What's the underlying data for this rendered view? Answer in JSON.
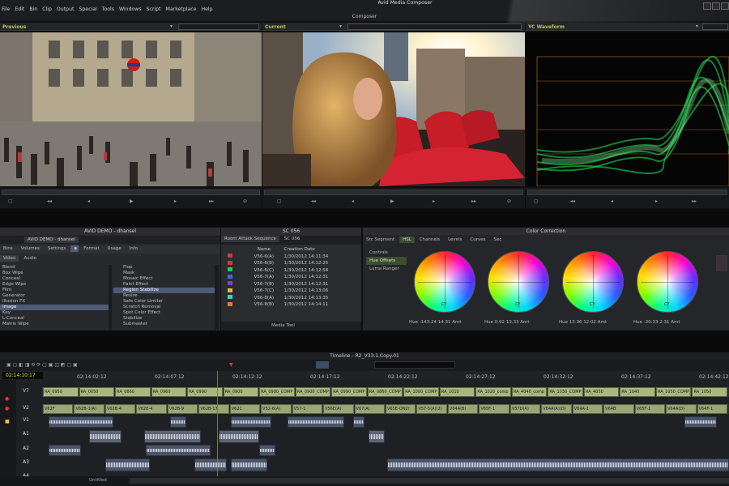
{
  "app": {
    "title": "Avid Media Composer",
    "composer_label": "Composer"
  },
  "menu": [
    "File",
    "Edit",
    "Bin",
    "Clip",
    "Output",
    "Special",
    "Tools",
    "Windows",
    "Script",
    "Marketplace",
    "Help"
  ],
  "monitors": {
    "previous": {
      "label": "Previous"
    },
    "current": {
      "label": "Current"
    },
    "waveform": {
      "label": "YC Waveform"
    }
  },
  "bin_panel": {
    "title": "AVID DEMO - dhansel",
    "tab_label": "AVID DEMO - dhansel",
    "tabs": [
      "Bins",
      "Volumes",
      "Settings",
      "Format",
      "Usage",
      "Info"
    ],
    "subtabs": [
      "Video",
      "Audio"
    ],
    "categories": [
      "Blend",
      "Box Wipe",
      "Conceal",
      "Edge Wipe",
      "Film",
      "Generator",
      "Illusion FX",
      "Image",
      "Key",
      "L-Conceal",
      "Matrix Wipe"
    ],
    "effects": [
      "Flop",
      "Mask",
      "Mosaic Effect",
      "Paint Effect",
      "Region Stabilize",
      "Resize",
      "Safe Color Limiter",
      "Scratch Removal",
      "Spot Color Effect",
      "Stabilize",
      "Submaster"
    ],
    "selected_category": "Image",
    "selected_effect": "Region Stabilize"
  },
  "scene_bin": {
    "title": "SC 056",
    "tabs": [
      "Room Attack Sequence",
      "SC 056"
    ],
    "columns": [
      "Name",
      "Creation Date"
    ],
    "rows": [
      {
        "name": "V56-6(A)",
        "date": "1/30/2012 14:11:34",
        "color": "#d23a3a"
      },
      {
        "name": "V56-6(B)",
        "date": "1/30/2012 14:12:25",
        "color": "#d23a3a"
      },
      {
        "name": "V56-6(C)",
        "date": "1/30/2012 14:12:58",
        "color": "#3ac25a"
      },
      {
        "name": "V56-7(A)",
        "date": "1/30/2012 14:12:31",
        "color": "#3a6ad2"
      },
      {
        "name": "V56-7(B)",
        "date": "1/30/2012 14:12:31",
        "color": "#8a3ad2"
      },
      {
        "name": "V56-7(C)",
        "date": "1/30/2012 14:13:06",
        "color": "#d2c23a"
      },
      {
        "name": "V56-8(A)",
        "date": "1/30/2012 14:13:35",
        "color": "#3ad2c2"
      },
      {
        "name": "V56-8(B)",
        "date": "1/30/2012 14:14:11",
        "color": "#d2803a"
      }
    ],
    "footer_label": "Media Tool"
  },
  "color_correction": {
    "title": "Color Correction",
    "tabs": [
      "Src Segment",
      "HSL",
      "Channels",
      "Levels",
      "Curves",
      "Sec"
    ],
    "side": [
      "Controls",
      "Hue Offsets",
      "Luma Ranger"
    ],
    "wheels": [
      {
        "label": "Hue",
        "hue": "-143.24",
        "amt_val": "14.31",
        "amt": "Amt"
      },
      {
        "label": "Hue",
        "hue": "0.92",
        "amt_val": "13.33",
        "amt": "Amt"
      },
      {
        "label": "Hue",
        "hue": "13.36",
        "amt_val": "12.02",
        "amt": "Amt"
      },
      {
        "label": "Hue",
        "hue": "-20.33",
        "amt_val": "2.31",
        "amt": "Amt"
      }
    ],
    "cy": "CY"
  },
  "timeline": {
    "title": "Timeline - R2_V33.1.Copy.01",
    "timecode": "02:14:10:17",
    "ruler": [
      "02:14:02:12",
      "02:14:07:12",
      "02:14:12:12",
      "02:14:17:12",
      "02:14:22:12",
      "02:14:27:12",
      "02:14:32:12",
      "02:14:37:12",
      "02:14:42:12"
    ],
    "tracks": [
      "V7",
      "V2",
      "V1",
      "A1",
      "A2",
      "A3",
      "A4"
    ],
    "v2_clips": [
      "RA_0950",
      "RA_0050",
      "RA_0860",
      "RA_0960",
      "RA_0990",
      "RA_0900",
      "RA_0980_COMP",
      "RA_0900_COMP",
      "RA_0990_COMP",
      "RA_0860_COMP",
      "RA_1000_COMP",
      "RA_1010",
      "RA_1020_comp",
      "RA_4040_comp",
      "RA_1030_COMP",
      "RA_4050",
      "RA_1040",
      "RA_1050_COMP_v081",
      "RA_1050"
    ],
    "v1_clips": [
      "V62F",
      "V62B-1(A)",
      "V62B-4",
      "V62E-4",
      "V62B-9",
      "V62B-17",
      "V62C",
      "V52-6(A)",
      "V57-1",
      "V56E(A)",
      "V67(A)",
      "V65E-ONLY",
      "V57-5(A)(2)",
      "V64A(B)",
      "V65F-1",
      "V57D(A)",
      "V64A(A)(D)",
      "V64A-1",
      "V64B",
      "V65F-1",
      "V64A(D)",
      "V64F-1"
    ],
    "footer_label": "Untitled"
  }
}
